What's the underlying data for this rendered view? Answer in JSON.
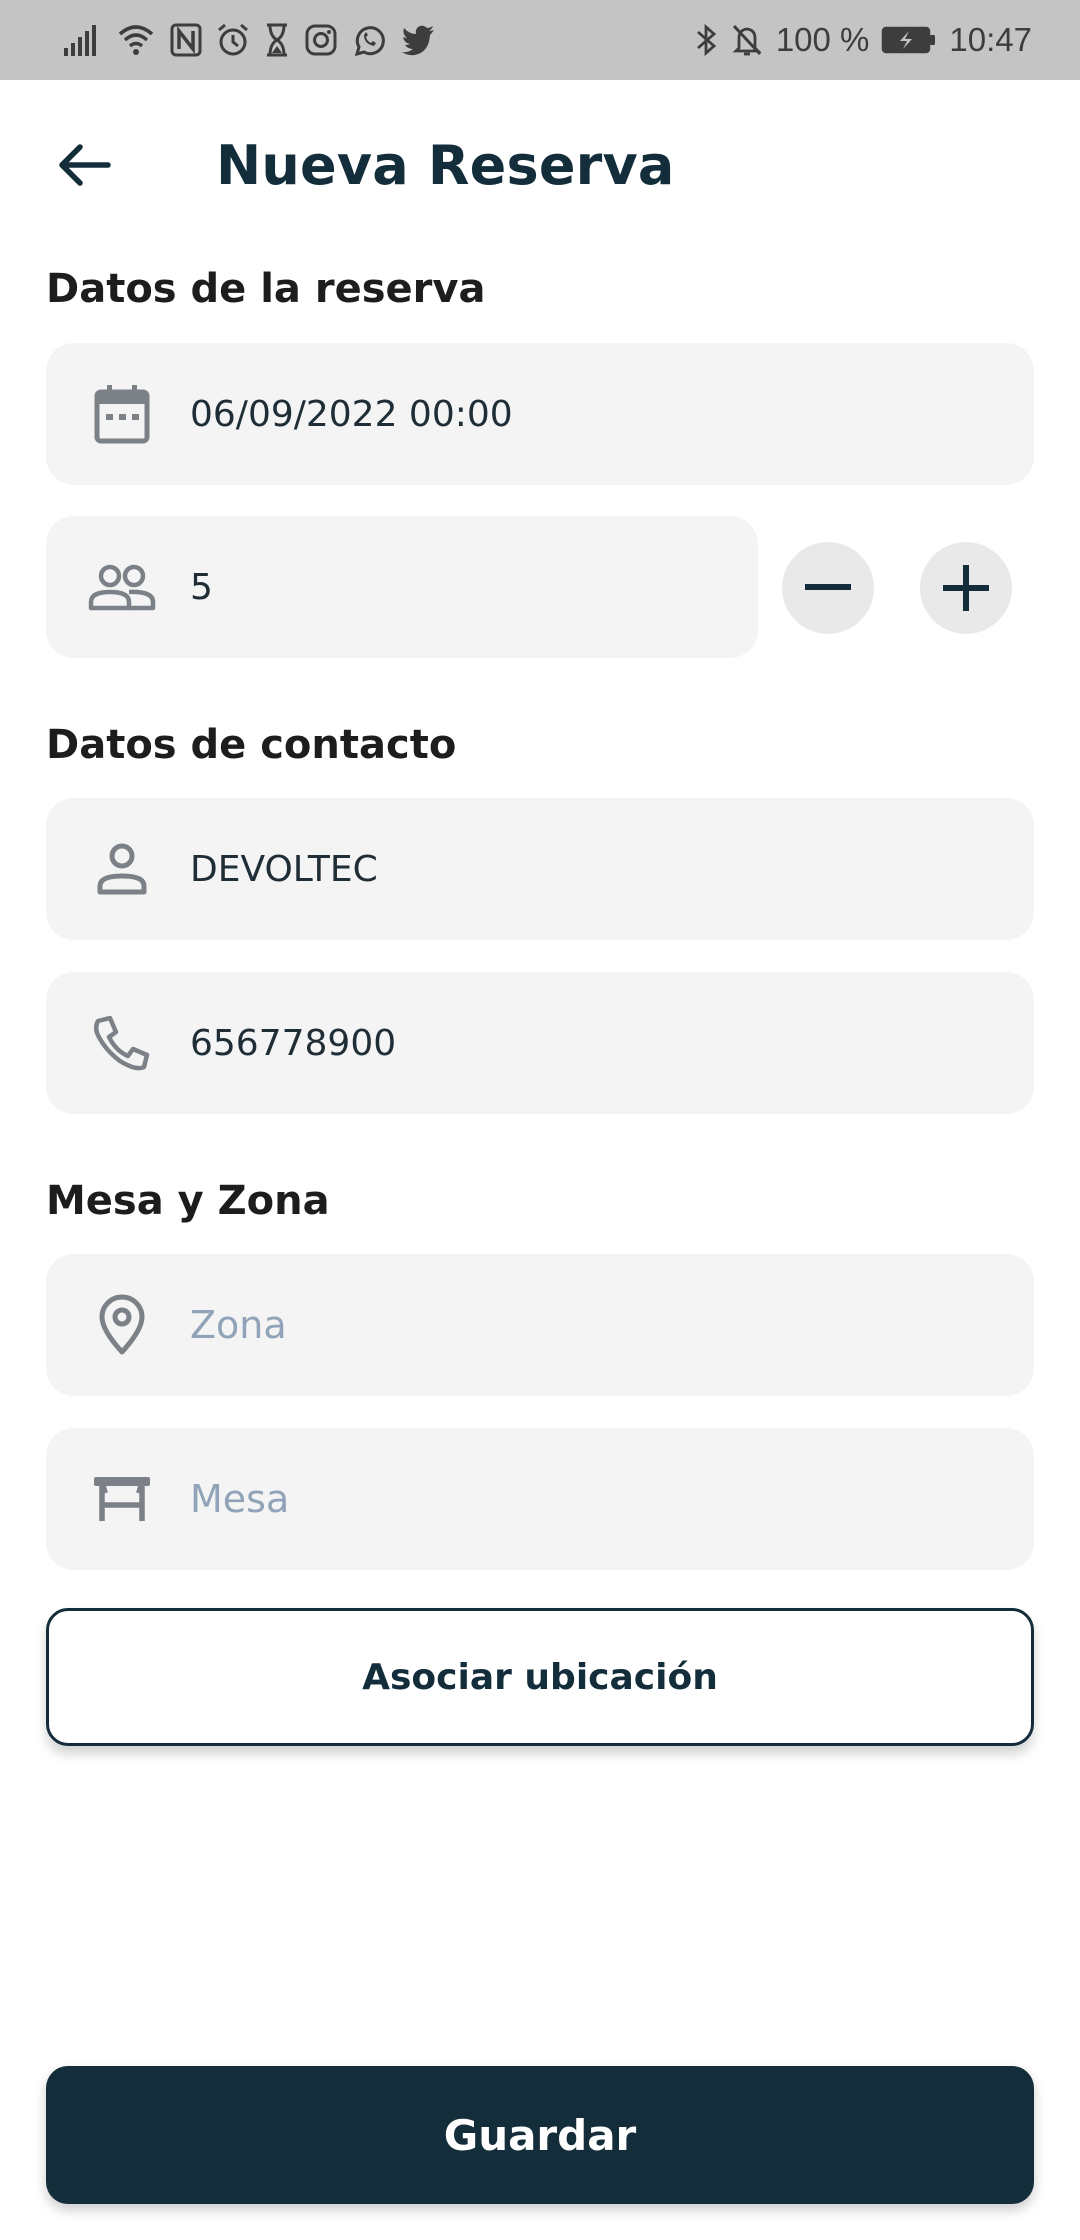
{
  "status_bar": {
    "battery_percent": "100 %",
    "time": "10:47",
    "left_icons": [
      "signal-icon",
      "wifi-icon",
      "nfc-icon",
      "alarm-icon",
      "hourglass-icon",
      "instagram-icon",
      "whatsapp-icon",
      "twitter-icon"
    ],
    "right_icons": [
      "bluetooth-icon",
      "mute-bell-icon",
      "battery-icon"
    ]
  },
  "header": {
    "title": "Nueva Reserva",
    "back_icon": "arrow-left-icon"
  },
  "reservation": {
    "section_title": "Datos de la reserva",
    "datetime": {
      "value": "06/09/2022 00:00",
      "icon": "calendar-icon"
    },
    "guests": {
      "value": "5",
      "icon": "people-icon",
      "minus_icon": "minus-icon",
      "plus_icon": "plus-icon"
    }
  },
  "contact": {
    "section_title": "Datos de contacto",
    "name": {
      "value": "DEVOLTEC",
      "icon": "person-icon"
    },
    "phone": {
      "value": "656778900",
      "icon": "phone-icon"
    }
  },
  "table_zone": {
    "section_title": "Mesa y Zona",
    "zone": {
      "placeholder": "Zona",
      "icon": "location-pin-icon"
    },
    "table": {
      "placeholder": "Mesa",
      "icon": "table-icon"
    }
  },
  "actions": {
    "associate_location": "Asociar ubicación",
    "save": "Guardar"
  },
  "colors": {
    "primary": "#132d3b",
    "field_bg": "#f4f4f4",
    "placeholder": "#90a3b8",
    "icon": "#7c8187",
    "status_bar_bg": "#c4c4c4"
  }
}
